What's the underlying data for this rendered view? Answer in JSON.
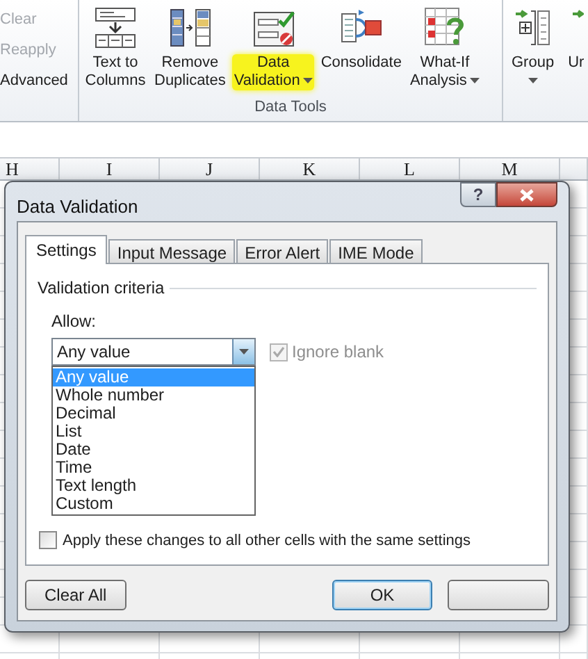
{
  "ribbon": {
    "sort_filter_items": [
      {
        "label": "Clear",
        "disabled": true
      },
      {
        "label": "Reapply",
        "disabled": true
      },
      {
        "label": "Advanced",
        "disabled": false
      }
    ],
    "data_tools": [
      {
        "kind": "text-to-columns",
        "label": "Text to\nColumns",
        "has_menu": false,
        "highlighted": false
      },
      {
        "kind": "remove-duplicates",
        "label": "Remove\nDuplicates",
        "has_menu": false,
        "highlighted": false
      },
      {
        "kind": "data-validation",
        "label": "Data\nValidation",
        "has_menu": true,
        "highlighted": true
      },
      {
        "kind": "consolidate",
        "label": "Consolidate",
        "has_menu": false,
        "highlighted": false
      },
      {
        "kind": "what-if",
        "label": "What-If\nAnalysis",
        "has_menu": true,
        "highlighted": false
      }
    ],
    "group_label": "Data Tools",
    "outline": [
      {
        "kind": "group",
        "label": "Group",
        "has_menu": true
      },
      {
        "kind": "ungroup",
        "label": "Ur",
        "has_menu": false
      }
    ]
  },
  "sheet": {
    "columns": [
      "H",
      "I",
      "J",
      "K",
      "L",
      "M"
    ]
  },
  "dialog": {
    "title": "Data Validation",
    "help_button": "?",
    "tabs": [
      {
        "label": "Settings",
        "selected": true
      },
      {
        "label": "Input Message",
        "selected": false
      },
      {
        "label": "Error Alert",
        "selected": false
      },
      {
        "label": "IME Mode",
        "selected": false
      }
    ],
    "section_title": "Validation criteria",
    "allow_label": "Allow:",
    "allow_value": "Any value",
    "allow_options": [
      {
        "label": "Any value",
        "selected": true
      },
      {
        "label": "Whole number",
        "selected": false
      },
      {
        "label": "Decimal",
        "selected": false
      },
      {
        "label": "List",
        "selected": false
      },
      {
        "label": "Date",
        "selected": false
      },
      {
        "label": "Time",
        "selected": false
      },
      {
        "label": "Text length",
        "selected": false
      },
      {
        "label": "Custom",
        "selected": false
      }
    ],
    "ignore_blank": {
      "label": "Ignore blank",
      "checked": true,
      "disabled": true
    },
    "apply_all": {
      "label": "Apply these changes to all other cells with the same settings",
      "checked": false
    },
    "buttons": [
      {
        "label": "Clear All",
        "default": false
      },
      {
        "label": "OK",
        "default": true
      },
      {
        "default": false
      }
    ]
  }
}
